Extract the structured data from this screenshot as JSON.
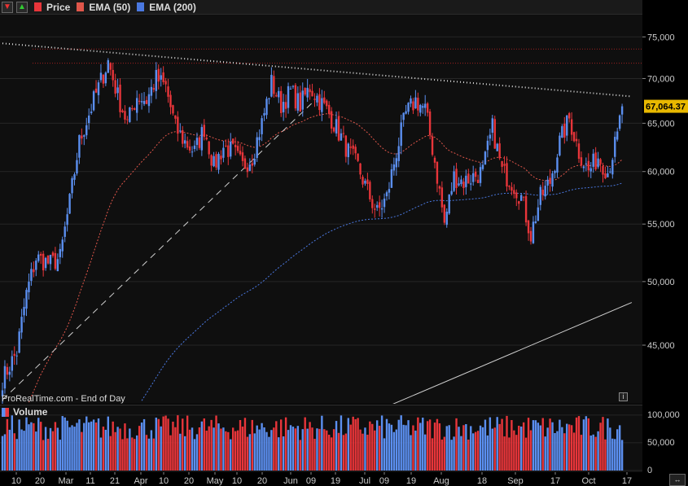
{
  "header": {
    "price_label": "Price",
    "ema50_label": "EMA (50)",
    "ema200_label": "EMA (200)"
  },
  "colors": {
    "up": "#5b8ff0",
    "down": "#e8353a",
    "ema50": "#e0564a",
    "ema200": "#4a78e0",
    "price_tag": "#e8b800"
  },
  "watermark": "ProRealTime.com - End of Day",
  "volume_label": "Volume",
  "chart_data": {
    "type": "candlestick",
    "last_price": "67,064.37",
    "y_ticks": [
      "75,000",
      "70,000",
      "65,000",
      "60,000",
      "55,000",
      "50,000",
      "45,000"
    ],
    "y_tick_values": [
      75000,
      70000,
      65000,
      60000,
      55000,
      50000,
      45000
    ],
    "y_scale": "log",
    "ylim": [
      41000,
      77500
    ],
    "volume_ticks": [
      "100,000",
      "50,000",
      "0"
    ],
    "volume_tick_values": [
      100000,
      50000,
      0
    ],
    "volume_max": 110000,
    "x_ticks": [
      "10",
      "20",
      "Mar",
      "11",
      "21",
      "Apr",
      "10",
      "20",
      "May",
      "10",
      "20",
      "Jun",
      "09",
      "19",
      "Jul",
      "09",
      "19",
      "Aug",
      "18",
      "Sep",
      "17",
      "Oct",
      "17"
    ],
    "close_anchors": [
      [
        0,
        42500
      ],
      [
        6,
        44500
      ],
      [
        10,
        49000
      ],
      [
        14,
        52000
      ],
      [
        20,
        51500
      ],
      [
        24,
        52000
      ],
      [
        28,
        57000
      ],
      [
        32,
        63000
      ],
      [
        36,
        66000
      ],
      [
        40,
        69000
      ],
      [
        44,
        72000
      ],
      [
        48,
        68000
      ],
      [
        52,
        65000
      ],
      [
        56,
        68000
      ],
      [
        60,
        67500
      ],
      [
        64,
        70000
      ],
      [
        68,
        69000
      ],
      [
        72,
        64500
      ],
      [
        76,
        63000
      ],
      [
        80,
        62000
      ],
      [
        84,
        64500
      ],
      [
        88,
        60500
      ],
      [
        92,
        62500
      ],
      [
        96,
        62000
      ],
      [
        100,
        60500
      ],
      [
        104,
        61500
      ],
      [
        108,
        65000
      ],
      [
        112,
        69500
      ],
      [
        116,
        67000
      ],
      [
        120,
        68500
      ],
      [
        124,
        67000
      ],
      [
        128,
        69000
      ],
      [
        132,
        67500
      ],
      [
        136,
        66000
      ],
      [
        140,
        64000
      ],
      [
        144,
        62000
      ],
      [
        148,
        60500
      ],
      [
        152,
        58000
      ],
      [
        156,
        56000
      ],
      [
        160,
        57500
      ],
      [
        164,
        62000
      ],
      [
        168,
        66000
      ],
      [
        172,
        67500
      ],
      [
        176,
        66500
      ],
      [
        180,
        61000
      ],
      [
        184,
        55000
      ],
      [
        188,
        59500
      ],
      [
        192,
        59000
      ],
      [
        196,
        59500
      ],
      [
        200,
        60000
      ],
      [
        204,
        64500
      ],
      [
        208,
        60000
      ],
      [
        212,
        59000
      ],
      [
        216,
        57500
      ],
      [
        220,
        54000
      ],
      [
        224,
        57500
      ],
      [
        228,
        59000
      ],
      [
        232,
        63000
      ],
      [
        236,
        65500
      ],
      [
        240,
        62000
      ],
      [
        244,
        60000
      ],
      [
        248,
        61500
      ],
      [
        252,
        60000
      ],
      [
        256,
        63500
      ],
      [
        258,
        67000
      ]
    ],
    "trendlines": [
      {
        "style": "dotted",
        "from": [
          0,
          74200
        ],
        "to": [
          262,
          67950
        ]
      },
      {
        "style": "dashed",
        "from": [
          0,
          41100
        ],
        "to": [
          130,
          67500
        ]
      },
      {
        "style": "solid",
        "from": [
          158,
          40500
        ],
        "to": [
          262,
          48300
        ]
      }
    ],
    "resistance_levels": [
      73500,
      71800
    ]
  }
}
